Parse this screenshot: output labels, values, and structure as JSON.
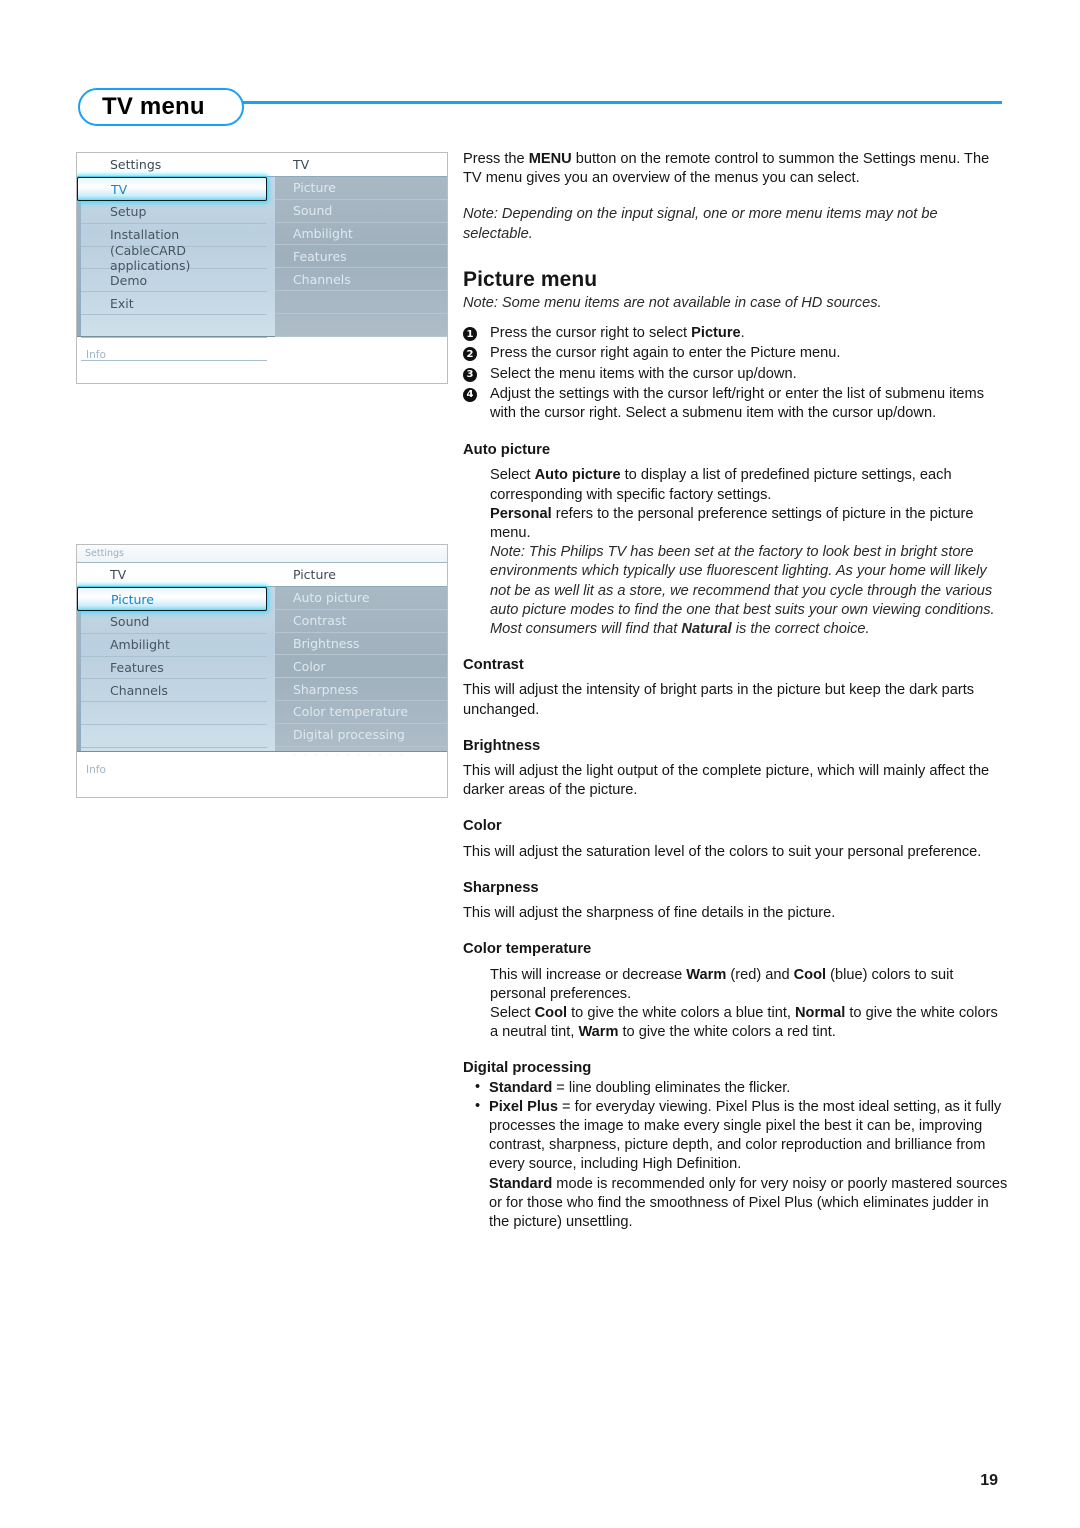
{
  "page": {
    "title": "TV menu",
    "number": "19"
  },
  "osd1": {
    "col_left_header": "Settings",
    "col_right_header": "TV",
    "left_items": [
      "TV",
      "Setup",
      "Installation",
      "(CableCARD applications)",
      "Demo",
      "Exit"
    ],
    "left_selected": "TV",
    "right_items": [
      "Picture",
      "Sound",
      "Ambilight",
      "Features",
      "Channels"
    ],
    "info_label": "Info"
  },
  "osd2": {
    "breadcrumb": "Settings",
    "col_left_header": "TV",
    "col_right_header": "Picture",
    "left_items": [
      "Picture",
      "Sound",
      "Ambilight",
      "Features",
      "Channels"
    ],
    "left_selected": "Picture",
    "right_items": [
      "Auto picture",
      "Contrast",
      "Brightness",
      "Color",
      "Sharpness",
      "Color temperature",
      "Digital processing"
    ],
    "scroll_dots": "· · · · · · · · · · ·",
    "info_label": "Info"
  },
  "intro": {
    "line1_a": "Press the ",
    "line1_b": "MENU",
    "line1_c": " button on the remote control to summon the Settings menu. The TV menu gives you an overview of the menus you can select.",
    "note": "Note: Depending on the input signal, one or more menu items may not be selectable."
  },
  "picture_menu": {
    "heading": "Picture menu",
    "note": "Note: Some menu items are not available in case of HD sources.",
    "steps": [
      {
        "num": "1",
        "text_a": "Press the cursor right to select ",
        "bold": "Picture",
        "text_b": "."
      },
      {
        "num": "2",
        "text_a": "Press the cursor right again to enter the Picture menu.",
        "bold": "",
        "text_b": ""
      },
      {
        "num": "3",
        "text_a": "Select the menu items with the cursor up/down.",
        "bold": "",
        "text_b": ""
      },
      {
        "num": "4",
        "text_a": "Adjust the settings with the cursor left/right or enter the list of submenu items with the cursor right. Select a submenu item with the cursor up/down.",
        "bold": "",
        "text_b": ""
      }
    ]
  },
  "auto_picture": {
    "heading": "Auto picture",
    "p1_a": "Select ",
    "p1_b": "Auto picture",
    "p1_c": " to display a list of predefined picture settings, each corresponding with specific factory settings.",
    "p2_b": "Personal",
    "p2_c": " refers to the personal preference settings of picture in the picture menu.",
    "note_a": "Note: This Philips TV has been set at the factory to look best in bright store environments which typically use fluorescent lighting. As your home will likely not be as well lit as a store, we recommend that you cycle through the various auto picture modes to find the one that best suits your own viewing conditions. Most consumers will find that ",
    "note_b": "Natural",
    "note_c": " is the correct choice."
  },
  "contrast": {
    "heading": "Contrast",
    "body": "This will adjust the intensity of bright parts in the picture but keep the dark parts unchanged."
  },
  "brightness": {
    "heading": "Brightness",
    "body": "This will adjust the light output of the complete picture, which will mainly affect the darker areas of the picture."
  },
  "color": {
    "heading": "Color",
    "body": "This will adjust the saturation level of the colors to suit your personal preference."
  },
  "sharpness": {
    "heading": "Sharpness",
    "body": "This will adjust the sharpness of fine details in the picture."
  },
  "color_temperature": {
    "heading": "Color temperature",
    "p1_a": "This will increase or decrease ",
    "p1_b": "Warm",
    "p1_c": " (red) and ",
    "p1_d": "Cool",
    "p1_e": " (blue) colors to suit personal preferences.",
    "p2_a": "Select ",
    "p2_b": "Cool",
    "p2_c": " to give the white colors a blue tint, ",
    "p2_d": "Normal",
    "p2_e": " to give the white colors a neutral tint, ",
    "p2_f": "Warm",
    "p2_g": " to give the white colors a red tint."
  },
  "digital_processing": {
    "heading": "Digital processing",
    "bullet1_b": "Standard",
    "bullet1_c": " = line doubling eliminates the flicker.",
    "bullet2_b": "Pixel Plus",
    "bullet2_c": " = for everyday viewing. Pixel Plus is the most ideal setting, as it fully processes the image to make every single pixel the best it can be, improving contrast, sharpness, picture depth, and color reproduction and brilliance from every source, including High Definition.",
    "tail_b": "Standard",
    "tail_c": " mode is recommended only for very noisy or poorly mastered sources or for those who find the smoothness of Pixel Plus (which eliminates judder in the picture) unsettling."
  },
  "colors": {
    "accent": "#1ba1f2",
    "osd_highlight": "#6fd9f7",
    "text": "#161616"
  }
}
